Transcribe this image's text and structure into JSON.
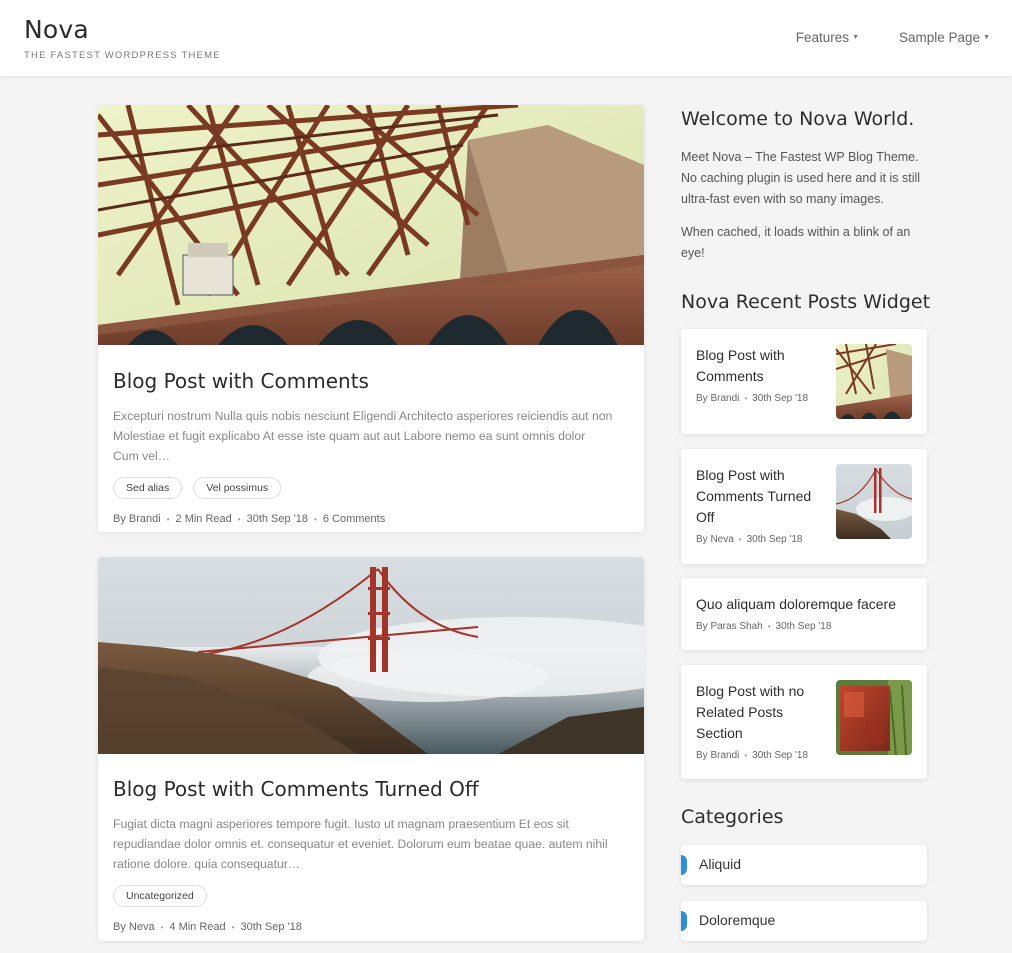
{
  "site": {
    "title": "Nova",
    "tagline": "THE FASTEST WORDPRESS THEME"
  },
  "nav": [
    {
      "label": "Features"
    },
    {
      "label": "Sample Page"
    }
  ],
  "posts": [
    {
      "title": "Blog Post with Comments",
      "excerpt": "Excepturi nostrum Nulla quis nobis nesciunt Eligendi Architecto asperiores reiciendis aut non Molestiae et fugit explicabo At esse iste quam aut aut Labore nemo ea sunt omnis dolor Cum vel…",
      "tags": [
        "Sed alias",
        "Vel possimus"
      ],
      "author": "By Brandi",
      "read_time": "2 Min Read",
      "date": "30th Sep '18",
      "comments": "6 Comments"
    },
    {
      "title": "Blog Post with Comments Turned Off",
      "excerpt": "Fugiat dicta magni asperiores tempore fugit. Iusto ut magnam praesentium Et eos sit repudiandae dolor omnis et. consequatur et eveniet. Dolorum eum beatae quae. autem nihil ratione dolore. quia consequatur…",
      "tags": [
        "Uncategorized"
      ],
      "author": "By Neva",
      "read_time": "4 Min Read",
      "date": "30th Sep '18"
    }
  ],
  "sidebar": {
    "welcome": {
      "title": "Welcome to Nova World.",
      "p1": "Meet Nova – The Fastest WP Blog Theme. No caching plugin is used here and it is still ultra-fast even with so many images.",
      "p2": "When cached, it loads within a blink of an eye!"
    },
    "recent_title": "Nova Recent Posts Widget",
    "recent": [
      {
        "title": "Blog Post with Comments",
        "author": "By Brandi",
        "date": "30th Sep '18"
      },
      {
        "title": "Blog Post with Comments Turned Off",
        "author": "By Neva",
        "date": "30th Sep '18"
      },
      {
        "title": "Quo aliquam doloremque facere",
        "author": "By Paras Shah",
        "date": "30th Sep '18"
      },
      {
        "title": "Blog Post with no Related Posts Section",
        "author": "By Brandi",
        "date": "30th Sep '18"
      }
    ],
    "categories_title": "Categories",
    "categories": [
      {
        "label": "Aliquid"
      },
      {
        "label": "Doloremque"
      }
    ]
  },
  "colors": {
    "accent": "#2f8fd6",
    "background": "#f4f4f5"
  }
}
